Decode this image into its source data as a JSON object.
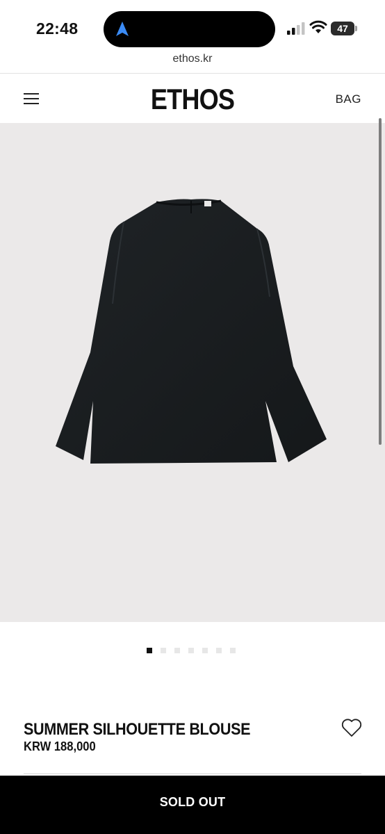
{
  "status_bar": {
    "time": "22:48",
    "battery_level": "47",
    "signal_bars": 2,
    "icons": [
      "navigation-arrow-icon",
      "signal-icon",
      "wifi-icon",
      "battery-icon"
    ]
  },
  "browser": {
    "url": "ethos.kr"
  },
  "header": {
    "logo": "ETHOS",
    "bag_label": "BAG",
    "menu_icon": "hamburger-menu-icon"
  },
  "gallery": {
    "image_description_icon": "blouse-product-photo",
    "total_images": 7,
    "active_index": 0,
    "background_color": "#ebe9e9"
  },
  "product": {
    "title": "SUMMER SILHOUETTE BLOUSE",
    "price": "KRW 188,000",
    "wishlist_icon": "heart-outline-icon"
  },
  "cta": {
    "label": "SOLD OUT",
    "color": "#000000"
  }
}
